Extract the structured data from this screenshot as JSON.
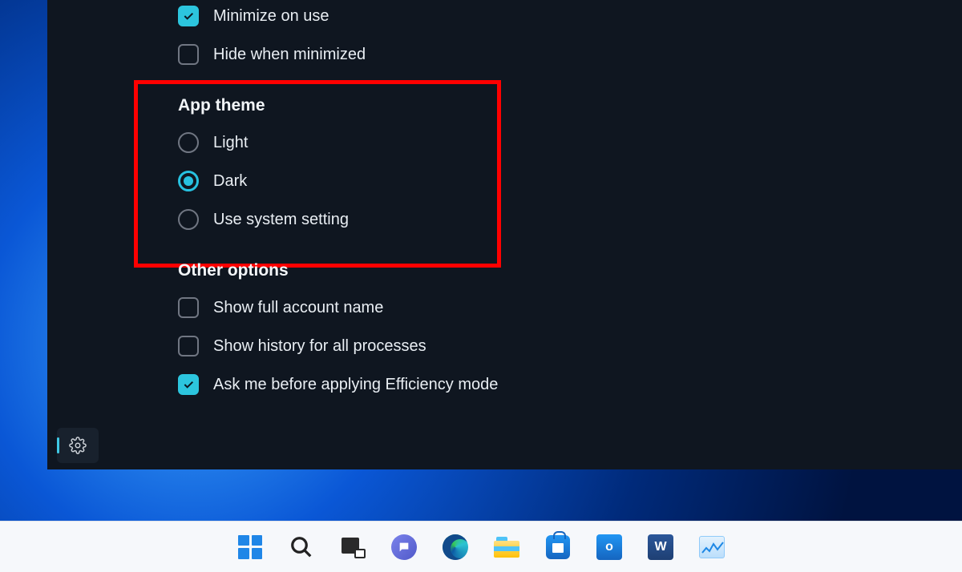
{
  "window_options": {
    "minimize_on_use": {
      "label": "Minimize on use",
      "checked": true
    },
    "hide_when_minimized": {
      "label": "Hide when minimized",
      "checked": false
    }
  },
  "app_theme": {
    "title": "App theme",
    "options": {
      "light": {
        "label": "Light",
        "selected": false
      },
      "dark": {
        "label": "Dark",
        "selected": true
      },
      "system": {
        "label": "Use system setting",
        "selected": false
      }
    }
  },
  "other_options": {
    "title": "Other options",
    "items": {
      "full_account": {
        "label": "Show full account name",
        "checked": false
      },
      "history_all": {
        "label": "Show history for all processes",
        "checked": false
      },
      "ask_efficiency": {
        "label": "Ask me before applying Efficiency mode",
        "checked": true
      }
    }
  },
  "office": {
    "outlook_letter": "o",
    "word_letter": "W"
  }
}
